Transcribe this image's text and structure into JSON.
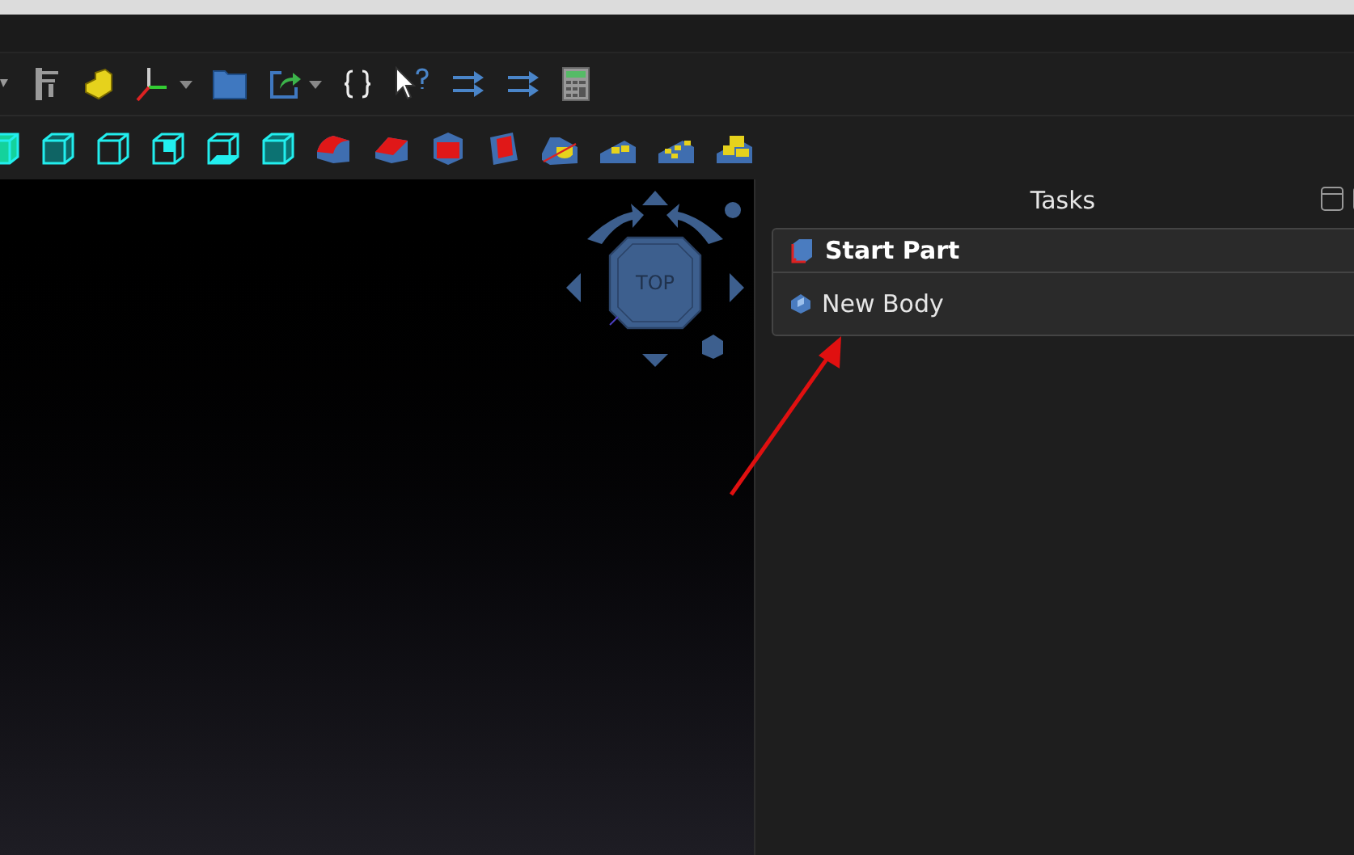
{
  "navigation_cube": {
    "face_label": "TOP"
  },
  "tasks_panel": {
    "title": "Tasks",
    "section": {
      "title": "Start Part",
      "items": [
        {
          "label": "New Body"
        }
      ]
    }
  }
}
